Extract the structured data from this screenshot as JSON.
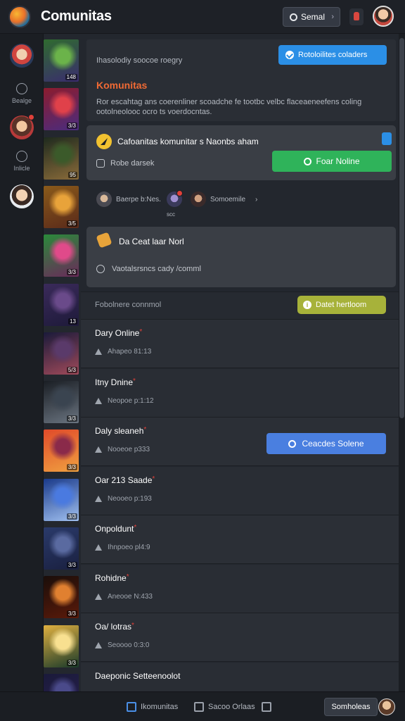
{
  "app": {
    "title": "Comunitas"
  },
  "topbar": {
    "send_label": "Semal"
  },
  "rail": [
    {
      "label": "Bealge"
    },
    {
      "label": "Inlicle"
    }
  ],
  "thumbnails": [
    {
      "level": "148",
      "colors": [
        "#2f6b2f",
        "#6bb34a",
        "#3a2c6e"
      ]
    },
    {
      "level": "3/3",
      "colors": [
        "#8c1c2e",
        "#e0414a",
        "#4a2c7e"
      ]
    },
    {
      "level": "95",
      "colors": [
        "#1e2a1e",
        "#3b5a2a",
        "#8a6b3a"
      ]
    },
    {
      "level": "3/5",
      "colors": [
        "#8a5a1a",
        "#e8a33a",
        "#5a2a1a"
      ]
    },
    {
      "level": "3/3",
      "colors": [
        "#2a8a3a",
        "#e04a8a",
        "#6a2a5a"
      ]
    },
    {
      "level": "13",
      "colors": [
        "#3a2a5a",
        "#6a4a8a",
        "#1e1a3a"
      ]
    },
    {
      "level": "5/3",
      "colors": [
        "#1a1a3a",
        "#5a3a6a",
        "#a04a5a"
      ]
    },
    {
      "level": "3/3",
      "colors": [
        "#1a1e24",
        "#3a4450",
        "#6a7480"
      ]
    },
    {
      "level": "3/3",
      "colors": [
        "#e04a2a",
        "#8a2a4a",
        "#f0a040"
      ]
    },
    {
      "level": "3/3",
      "colors": [
        "#1a3a8a",
        "#4a7ae0",
        "#a0c0f0"
      ]
    },
    {
      "level": "3/3",
      "colors": [
        "#2a3a6a",
        "#5a6aa0",
        "#1a2040"
      ]
    },
    {
      "level": "3/3",
      "colors": [
        "#1a0e0a",
        "#e08030",
        "#5a1a0a"
      ]
    },
    {
      "level": "3/3",
      "colors": [
        "#e0b040",
        "#f8e090",
        "#1a3a2a"
      ]
    },
    {
      "level": "",
      "colors": [
        "#1a1a3a",
        "#4a4a8a",
        "#2a2050"
      ]
    }
  ],
  "hero": {
    "top_line": "Ihasolodiy soocoe roegry",
    "title": "Komunitas",
    "desc": "Ror escahtag ans coerenliner scoadche fe tootbc velbc flaceaeneefens coling ootolneolooc ocro ts voerdocntas.",
    "button_label": "Rotoloilites coladers"
  },
  "card1": {
    "label": "Cafoanitas komunitar s Naonbs aham",
    "sub": "Robe darsek",
    "button_label": "Foar Noline"
  },
  "people": {
    "left": "Baerpe b:Nes.",
    "mid": "scc",
    "right": "Somoemile"
  },
  "card2": {
    "label": "Da Ceat laar Norl",
    "sub": "Vaotalsrsncs cady /comml"
  },
  "section": {
    "label": "Fobolnere connmol",
    "button_label": "Datet hertloom"
  },
  "rows": [
    {
      "name": "Dary Online",
      "meta": "Ahapeo 81:13"
    },
    {
      "name": "Itny Dnine",
      "meta": "Neopoe p:1:12"
    },
    {
      "name": "Daly sleaneh",
      "meta": "Nooeoe p333",
      "button_label": "Ceacdes Solene"
    },
    {
      "name": "Oar 213 Saade",
      "meta": "Neooeo p:193"
    },
    {
      "name": "Onpoldunt",
      "meta": "Ihnpoeo pl4:9"
    },
    {
      "name": "Rohidne",
      "meta": "Aneooe N:433"
    },
    {
      "name": "Oa/ lotras",
      "meta": "Seoooo 0:3:0"
    },
    {
      "name": "Daeponic Setteenoolot",
      "meta": ""
    }
  ],
  "bottom": {
    "item1": "Ikomunitas",
    "item2": "Sacoo Orlaas",
    "button_label": "Somholeas"
  }
}
